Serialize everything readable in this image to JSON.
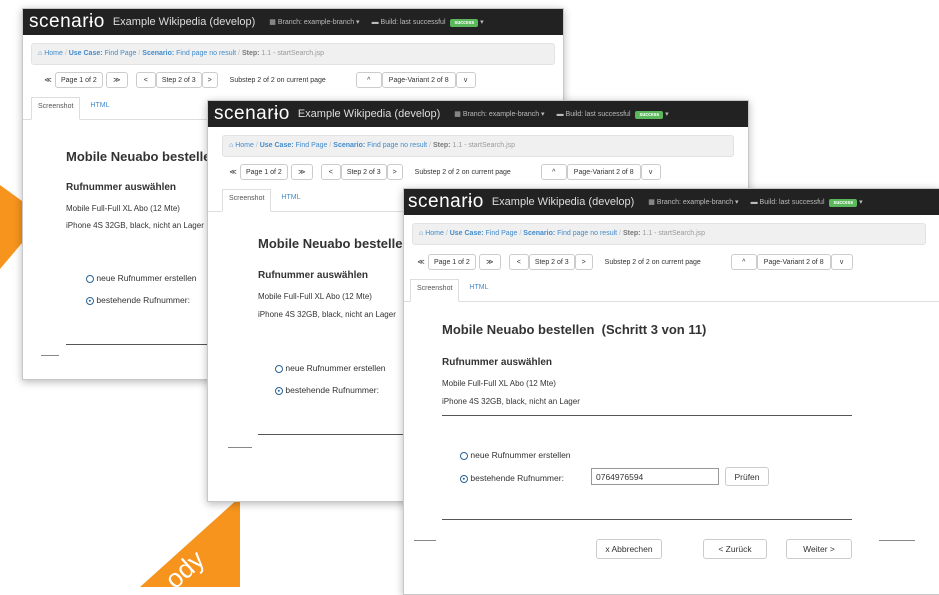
{
  "app": {
    "logo": "scenarɨo",
    "title": "Example Wikipedia (develop)",
    "branch": "Branch: example-branch",
    "build": "Build: last successful",
    "badge": "success"
  },
  "breadcrumb": {
    "home": "Home",
    "use_case_label": "Use Case:",
    "use_case": "Find Page",
    "scenario_label": "Scenario:",
    "scenario": "Find page no result",
    "step_label": "Step:",
    "step": "1.1 - startSearch.jsp"
  },
  "nav": {
    "first": "≪",
    "page": "Page 1 of 2",
    "next_page": "≫",
    "prev_step": "<",
    "step": "Step 2 of 3",
    "next_step": ">",
    "substep": "Substep 2 of 2 on current page",
    "up": "^",
    "variant": "Page-Variant 2 of 8",
    "down": "v"
  },
  "tabs": [
    "Screenshot",
    "HTML"
  ],
  "page": {
    "heading": "Mobile Neuabo bestellen",
    "heading_full": "Mobile Neuabo bestellen  (Schritt 3 von 11)",
    "section": "Rufnummer auswählen",
    "line1": "Mobile Full-Full XL Abo (12 Mte)",
    "line2": "iPhone 4S 32GB, black, nicht an Lager",
    "option_new": "neue Rufnummer erstellen",
    "option_existing": "bestehende Rufnummer:",
    "phone_value": "0764976594",
    "check_button": "Prüfen",
    "cancel_button": "x Abbrechen",
    "back_button": "< Zurück",
    "next_button": "Weiter >"
  },
  "watermark": "ody",
  "colors": {
    "topbar": "#222222",
    "success": "#5cb85c",
    "link": "#428bca",
    "arrow": "#f7941d"
  }
}
